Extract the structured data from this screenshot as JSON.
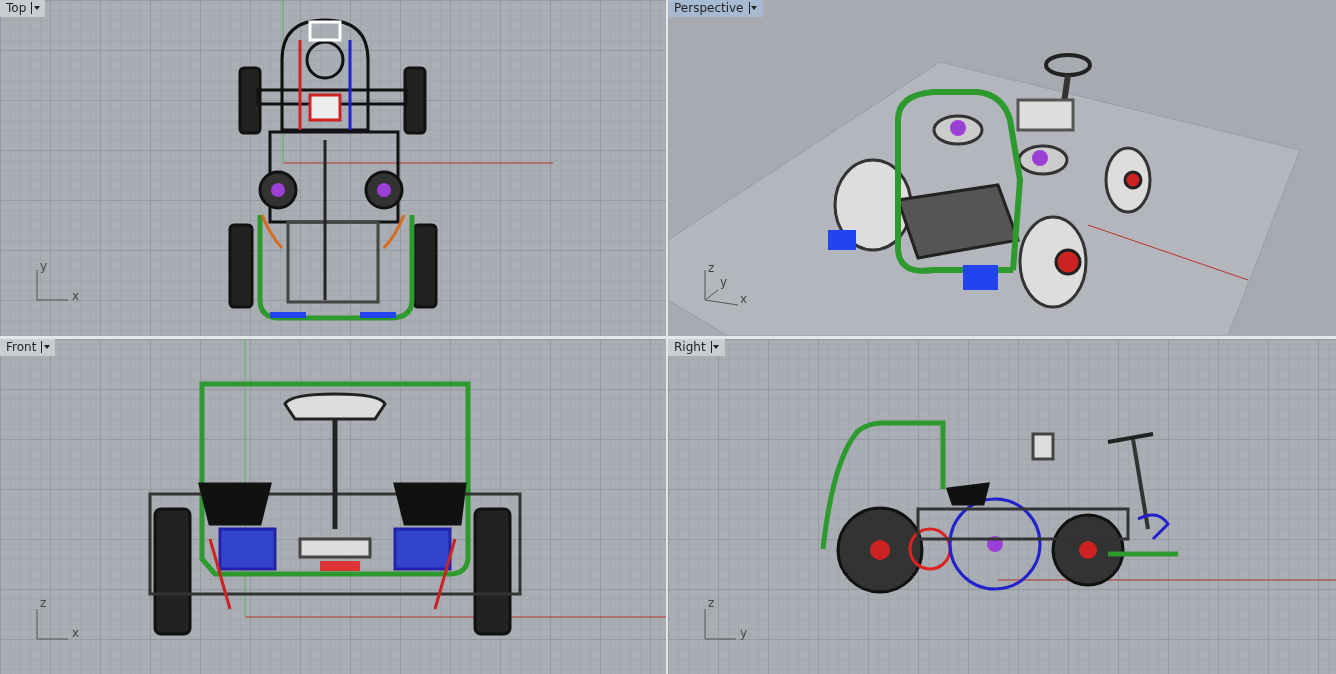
{
  "viewports": [
    {
      "title": "Top",
      "selected": false,
      "kind": "top",
      "axes": [
        "y",
        "x"
      ]
    },
    {
      "title": "Perspective",
      "selected": true,
      "kind": "perspective",
      "axes": [
        "z",
        "y",
        "x"
      ]
    },
    {
      "title": "Front",
      "selected": false,
      "kind": "front",
      "axes": [
        "z",
        "x"
      ]
    },
    {
      "title": "Right",
      "selected": false,
      "kind": "right",
      "axes": [
        "z",
        "y"
      ]
    }
  ]
}
